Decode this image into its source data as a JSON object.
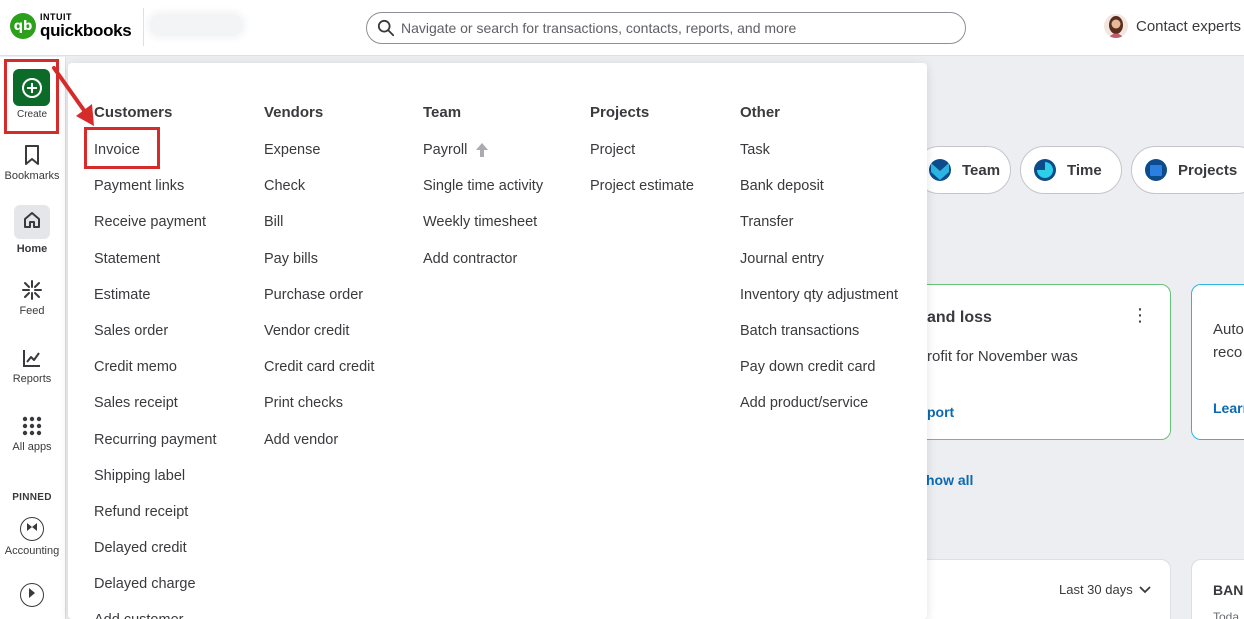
{
  "brand": {
    "intuit": "INTUIT",
    "product": "quickbooks",
    "mark": "qb",
    "color": "#2ca01c"
  },
  "search": {
    "placeholder": "Navigate or search for transactions, contacts, reports, and more"
  },
  "header": {
    "contact_label": "Contact experts"
  },
  "nav": {
    "create": "Create",
    "bookmarks": "Bookmarks",
    "home": "Home",
    "feed": "Feed",
    "reports": "Reports",
    "all_apps": "All apps",
    "pinned": "PINNED",
    "accounting": "Accounting"
  },
  "dashboard": {
    "chips": [
      "Team",
      "Time",
      "Projects"
    ],
    "pl_card": {
      "title": "and loss",
      "text": "rofit for November was",
      "link": "port"
    },
    "side_card": {
      "line1": "Auto",
      "line2": "reco",
      "link": "Learn"
    },
    "show_all": "how all",
    "bottom_filter": "Last 30 days",
    "bottom_right": "BANK",
    "bottom_right_sub": "Toda"
  },
  "menu": {
    "columns": [
      {
        "heading": "Customers",
        "items": [
          "Invoice",
          "Payment links",
          "Receive payment",
          "Statement",
          "Estimate",
          "Sales order",
          "Credit memo",
          "Sales receipt",
          "Recurring payment",
          "Shipping label",
          "Refund receipt",
          "Delayed credit",
          "Delayed charge",
          "Add customer"
        ]
      },
      {
        "heading": "Vendors",
        "items": [
          "Expense",
          "Check",
          "Bill",
          "Pay bills",
          "Purchase order",
          "Vendor credit",
          "Credit card credit",
          "Print checks",
          "Add vendor"
        ]
      },
      {
        "heading": "Team",
        "items": [
          "Payroll",
          "Single time activity",
          "Weekly timesheet",
          "Add contractor"
        ]
      },
      {
        "heading": "Projects",
        "items": [
          "Project",
          "Project estimate"
        ]
      },
      {
        "heading": "Other",
        "items": [
          "Task",
          "Bank deposit",
          "Transfer",
          "Journal entry",
          "Inventory qty adjustment",
          "Batch transactions",
          "Pay down credit card",
          "Add product/service"
        ]
      }
    ]
  },
  "colors": {
    "create_bg": "#0d6b2a",
    "highlight": "#d52b2b",
    "link": "#0b6ab3"
  }
}
